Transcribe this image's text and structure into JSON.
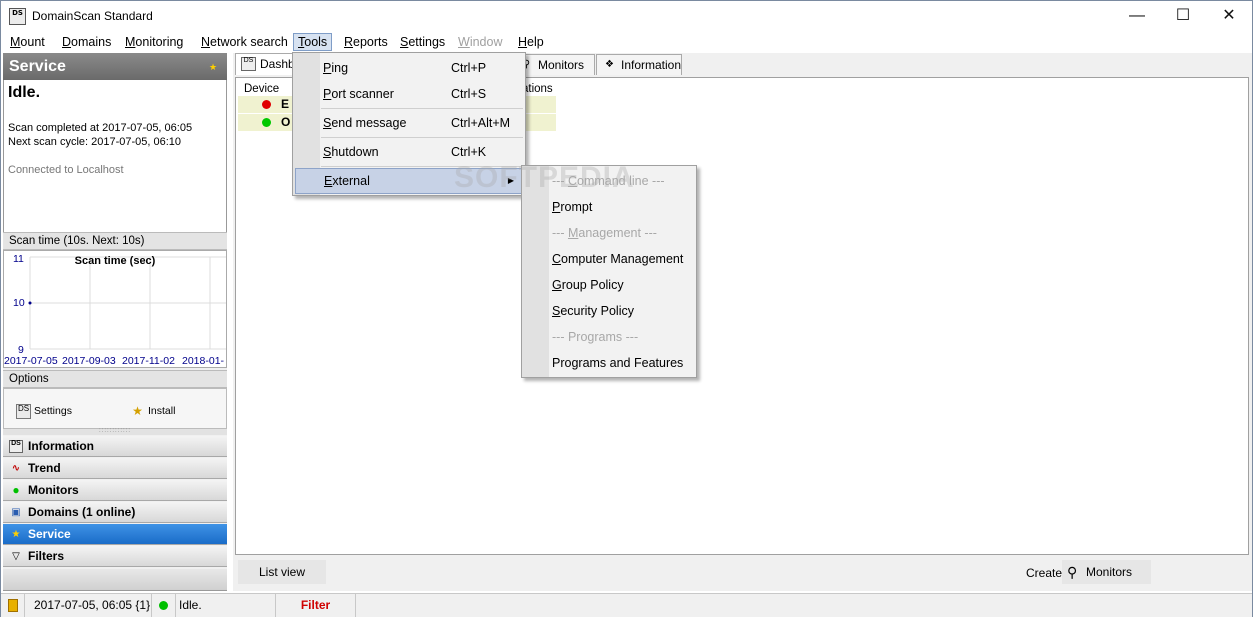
{
  "window": {
    "title": "DomainScan Standard",
    "app_icon_text": "DS"
  },
  "menubar": {
    "items": [
      {
        "label": "Mount",
        "underline": "M",
        "rest": "ount"
      },
      {
        "label": "Domains",
        "underline": "D",
        "rest": "omains"
      },
      {
        "label": "Monitoring",
        "underline": "M",
        "rest": "onitoring"
      },
      {
        "label": "Network search",
        "underline": "N",
        "rest": "etwork search"
      },
      {
        "label": "Tools",
        "underline": "T",
        "rest": "ools"
      },
      {
        "label": "Reports",
        "underline": "R",
        "rest": "eports"
      },
      {
        "label": "Settings",
        "underline": "S",
        "rest": "ettings"
      },
      {
        "label": "Window",
        "underline": "W",
        "rest": "indow"
      },
      {
        "label": "Help",
        "underline": "H",
        "rest": "elp"
      }
    ]
  },
  "service": {
    "header": "Service",
    "status": "Idle.",
    "scan_completed": "Scan completed at 2017-07-05, 06:05",
    "next_scan": "Next scan cycle: 2017-07-05, 06:10",
    "connected": "Connected to Localhost"
  },
  "scan_time": {
    "header": "Scan time (10s. Next: 10s)"
  },
  "chart_data": {
    "type": "line",
    "title": "Scan time (sec)",
    "x": [
      "2017-07-05"
    ],
    "series": [
      {
        "values": [
          10
        ]
      }
    ],
    "x_tick_labels": [
      "2017-07-05",
      "2017-09-03",
      "2017-11-02",
      "2018-01-"
    ],
    "y_tick_labels": [
      "11",
      "10",
      "9"
    ],
    "ylim": [
      9,
      11
    ],
    "grid": true
  },
  "options": {
    "header": "Options",
    "settings_label": "Settings",
    "install_label": "Install",
    "ds_icon_text": "DS"
  },
  "nav": {
    "information": "Information",
    "trend": "Trend",
    "monitors": "Monitors",
    "domains": "Domains (1 online)",
    "service": "Service",
    "filters": "Filters"
  },
  "tabs": {
    "dashboard": "Dashb",
    "monitors": "Monitors",
    "information": "Information"
  },
  "grid": {
    "col_device": "Device",
    "col_ations": "ations",
    "rows": [
      {
        "text": "E",
        "color": "#e00000"
      },
      {
        "text": "O",
        "color": "#00c800"
      }
    ]
  },
  "bottom": {
    "list_view": "List view",
    "create_label": "Create:",
    "create_monitors": "Monitors"
  },
  "statusbar": {
    "date": "2017-07-05, 06:05 {1}",
    "status": "Idle.",
    "filter": "Filter"
  },
  "tools_menu": {
    "ping": {
      "pre": "",
      "u": "P",
      "rest": "ing",
      "shortcut": "Ctrl+P"
    },
    "port_scanner": {
      "pre": "",
      "u": "P",
      "rest": "ort scanner",
      "shortcut": "Ctrl+S"
    },
    "send_message": {
      "pre": "",
      "u": "S",
      "rest": "end message",
      "shortcut": "Ctrl+Alt+M"
    },
    "shutdown": {
      "pre": "",
      "u": "S",
      "rest": "hutdown",
      "shortcut": "Ctrl+K"
    },
    "external": {
      "pre": "",
      "u": "E",
      "rest": "xternal"
    }
  },
  "external_menu": {
    "cmd_header": {
      "pre": "--- ",
      "u": "C",
      "rest": "ommand line ---"
    },
    "prompt": {
      "pre": "",
      "u": "P",
      "rest": "rompt"
    },
    "mgmt_header": {
      "pre": "--- ",
      "u": "M",
      "rest": "anagement ---"
    },
    "computer_mgmt": {
      "pre": "",
      "u": "C",
      "rest": "omputer Management"
    },
    "group_policy": {
      "pre": "",
      "u": "G",
      "rest": "roup Policy"
    },
    "security_policy": {
      "pre": "",
      "u": "S",
      "rest": "ecurity Policy"
    },
    "programs_header": {
      "pre": "--- Programs ---",
      "u": "",
      "rest": ""
    },
    "programs_features": {
      "pre": "Programs and Features",
      "u": "",
      "rest": ""
    }
  },
  "watermark": "SOFTPEDIA",
  "colors": {
    "selected_nav": "#1a6cc8",
    "status_filter": "#d00000",
    "menu_highlight": "#c7d2e6"
  }
}
